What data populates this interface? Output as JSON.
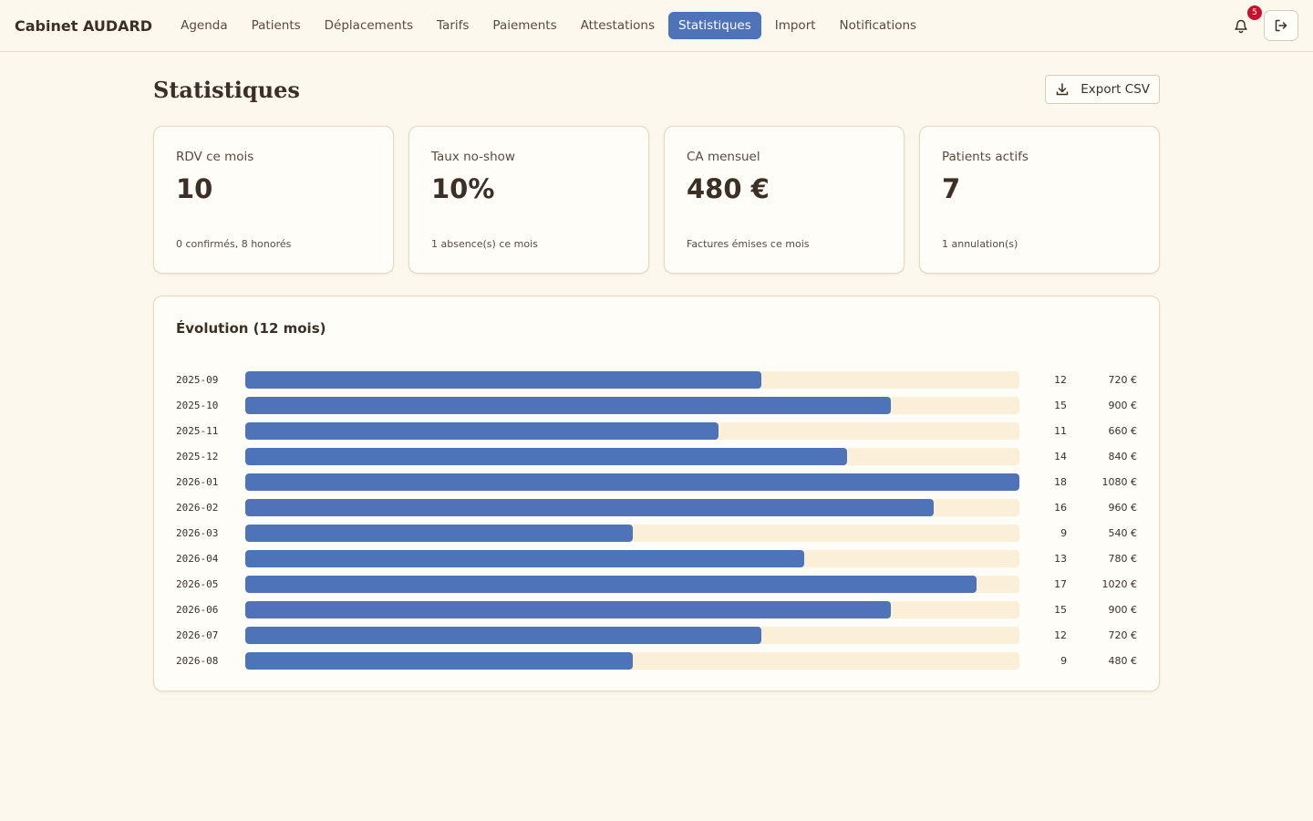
{
  "app": {
    "brand": "Cabinet AUDARD"
  },
  "nav": {
    "items": [
      {
        "label": "Agenda",
        "active": false
      },
      {
        "label": "Patients",
        "active": false
      },
      {
        "label": "Déplacements",
        "active": false
      },
      {
        "label": "Tarifs",
        "active": false
      },
      {
        "label": "Paiements",
        "active": false
      },
      {
        "label": "Attestations",
        "active": false
      },
      {
        "label": "Statistiques",
        "active": true
      },
      {
        "label": "Import",
        "active": false
      },
      {
        "label": "Notifications",
        "active": false
      }
    ],
    "notifications_count": "5",
    "icons": {
      "bell": "bell-icon",
      "logout": "logout-icon"
    }
  },
  "page": {
    "title": "Statistiques",
    "export_label": "Export CSV",
    "export_icon": "download-icon"
  },
  "cards": [
    {
      "label": "RDV ce mois",
      "value": "10",
      "sub": "0 confirmés, 8 honorés"
    },
    {
      "label": "Taux no-show",
      "value": "10%",
      "sub": "1 absence(s) ce mois"
    },
    {
      "label": "CA mensuel",
      "value": "480 €",
      "sub": "Factures émises ce mois"
    },
    {
      "label": "Patients actifs",
      "value": "7",
      "sub": "1 annulation(s)"
    }
  ],
  "chart": {
    "title": "Évolution (12 mois)"
  },
  "chart_data": {
    "type": "bar",
    "orientation": "horizontal",
    "categories": [
      "2025-09",
      "2025-10",
      "2025-11",
      "2025-12",
      "2026-01",
      "2026-02",
      "2026-03",
      "2026-04",
      "2026-05",
      "2026-06",
      "2026-07",
      "2026-08"
    ],
    "values": [
      12,
      15,
      11,
      14,
      18,
      16,
      9,
      13,
      17,
      15,
      12,
      9
    ],
    "amounts": [
      "720 €",
      "900 €",
      "660 €",
      "840 €",
      "1080 €",
      "960 €",
      "540 €",
      "780 €",
      "1020 €",
      "900 €",
      "720 €",
      "480 €"
    ],
    "xlim": [
      0,
      18
    ],
    "colors": {
      "bar": "#4f73b8",
      "track": "#fcefd8"
    }
  },
  "colors": {
    "accent": "#4f73b8",
    "background": "#fdf8ee",
    "badge": "#c8102e"
  }
}
